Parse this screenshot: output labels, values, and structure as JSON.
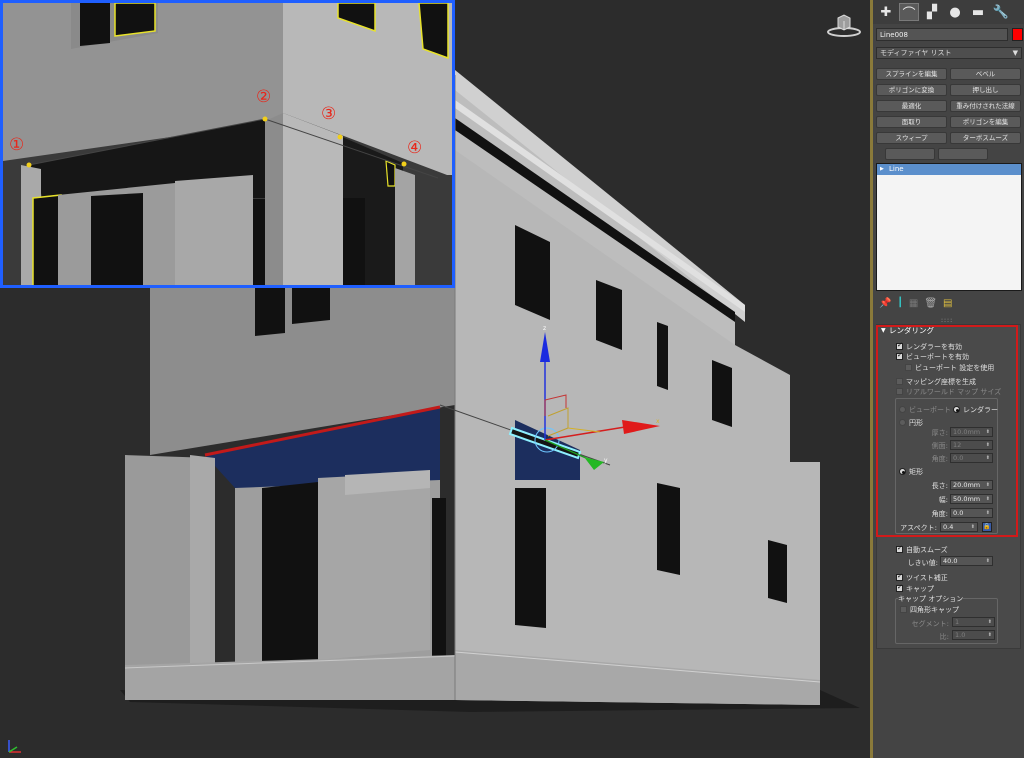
{
  "inset_markers": [
    "①",
    "②",
    "③",
    "④"
  ],
  "panel": {
    "tabs": [
      {
        "icon": "create-plus-icon",
        "glyph": "✚"
      },
      {
        "icon": "modify-curve-icon",
        "glyph": "⌒"
      },
      {
        "icon": "hierarchy-icon",
        "glyph": "▞"
      },
      {
        "icon": "motion-circle-icon",
        "glyph": "●"
      },
      {
        "icon": "display-monitor-icon",
        "glyph": "▬"
      },
      {
        "icon": "utilities-wrench-icon",
        "glyph": "🔧"
      }
    ],
    "object_name": "Line008",
    "object_color": "#ff0000",
    "modifier_list": "モディファイヤ リスト",
    "buttons": [
      "スプラインを編集",
      "ベベル",
      "ポリゴンに変換",
      "押し出し",
      "最適化",
      "重み付けされた法線",
      "面取り",
      "ポリゴンを編集",
      "スウィープ",
      "ターボスムーズ"
    ],
    "stack_item": "Line",
    "rollout_title": "レンダリング",
    "enable_renderer": "レンダラーを有効",
    "enable_viewport": "ビューポートを有効",
    "use_viewport_settings": "ビューポート 設定を使用",
    "gen_mapping": "マッピング座標を生成",
    "real_world_map": "リアルワールド マップ サイズ",
    "opt_viewport": "ビューポート",
    "opt_renderer": "レンダラー",
    "radial": "円形",
    "thickness_label": "厚さ:",
    "thickness_val": "10.0mm",
    "sides_label": "側面:",
    "sides_val": "12",
    "angle_label1": "角度:",
    "angle_val1": "0.0",
    "rectangular": "矩形",
    "length_label": "長さ:",
    "length_val": "20.0mm",
    "width_label": "幅:",
    "width_val": "50.0mm",
    "angle_label2": "角度:",
    "angle_val2": "0.0",
    "aspect_label": "アスペクト:",
    "aspect_val": "0.4",
    "auto_smooth": "自動スムーズ",
    "threshold_label": "しきい値:",
    "threshold_val": "40.0",
    "twist_correction": "ツイスト補正",
    "cap": "キャップ",
    "cap_options": "キャップ オプション",
    "quad_cap": "四角形キャップ",
    "segments_label": "セグメント:",
    "segments_val": "1",
    "ratio_label": "比:",
    "ratio_val": "1.0"
  }
}
